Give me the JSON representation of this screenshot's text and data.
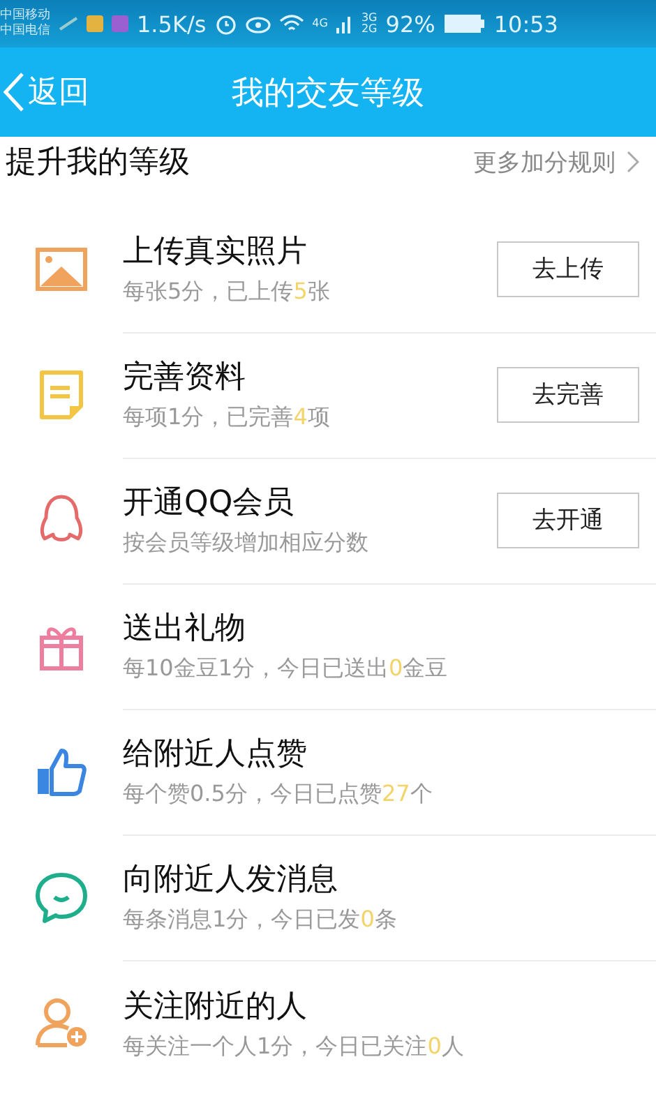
{
  "status_bar": {
    "carriers": [
      "中国移动",
      "中国电信"
    ],
    "speed": "1.5K/s",
    "network_1": "4G",
    "network_2": [
      "3G",
      "2G"
    ],
    "battery": "92%",
    "time": "10:53"
  },
  "nav": {
    "back": "返回",
    "title": "我的交友等级"
  },
  "section": {
    "title": "提升我的等级",
    "link": "更多加分规则"
  },
  "items": [
    {
      "title": "上传真实照片",
      "subtitle": [
        {
          "text": "每张5分，已上传",
          "highlight": false
        },
        {
          "text": "5",
          "highlight": true
        },
        {
          "text": "张",
          "highlight": false
        }
      ],
      "button": "去上传"
    },
    {
      "title": "完善资料",
      "subtitle": [
        {
          "text": "每项1分，已完善",
          "highlight": false
        },
        {
          "text": "4",
          "highlight": true
        },
        {
          "text": "项",
          "highlight": false
        }
      ],
      "button": "去完善"
    },
    {
      "title": "开通QQ会员",
      "subtitle": [
        {
          "text": "按会员等级增加相应分数",
          "highlight": false
        }
      ],
      "button": "去开通"
    },
    {
      "title": "送出礼物",
      "subtitle": [
        {
          "text": "每10金豆1分，今日已送出",
          "highlight": false
        },
        {
          "text": "0",
          "highlight": true
        },
        {
          "text": "金豆",
          "highlight": false
        }
      ]
    },
    {
      "title": "给附近人点赞",
      "subtitle": [
        {
          "text": "每个赞0.5分，今日已点赞",
          "highlight": false
        },
        {
          "text": "27",
          "highlight": true
        },
        {
          "text": "个",
          "highlight": false
        }
      ]
    },
    {
      "title": "向附近人发消息",
      "subtitle": [
        {
          "text": "每条消息1分，今日已发",
          "highlight": false
        },
        {
          "text": "0",
          "highlight": true
        },
        {
          "text": "条",
          "highlight": false
        }
      ]
    },
    {
      "title": "关注附近的人",
      "subtitle": [
        {
          "text": "每关注一个人1分，今日已关注",
          "highlight": false
        },
        {
          "text": "0",
          "highlight": true
        },
        {
          "text": "人",
          "highlight": false
        }
      ]
    }
  ]
}
